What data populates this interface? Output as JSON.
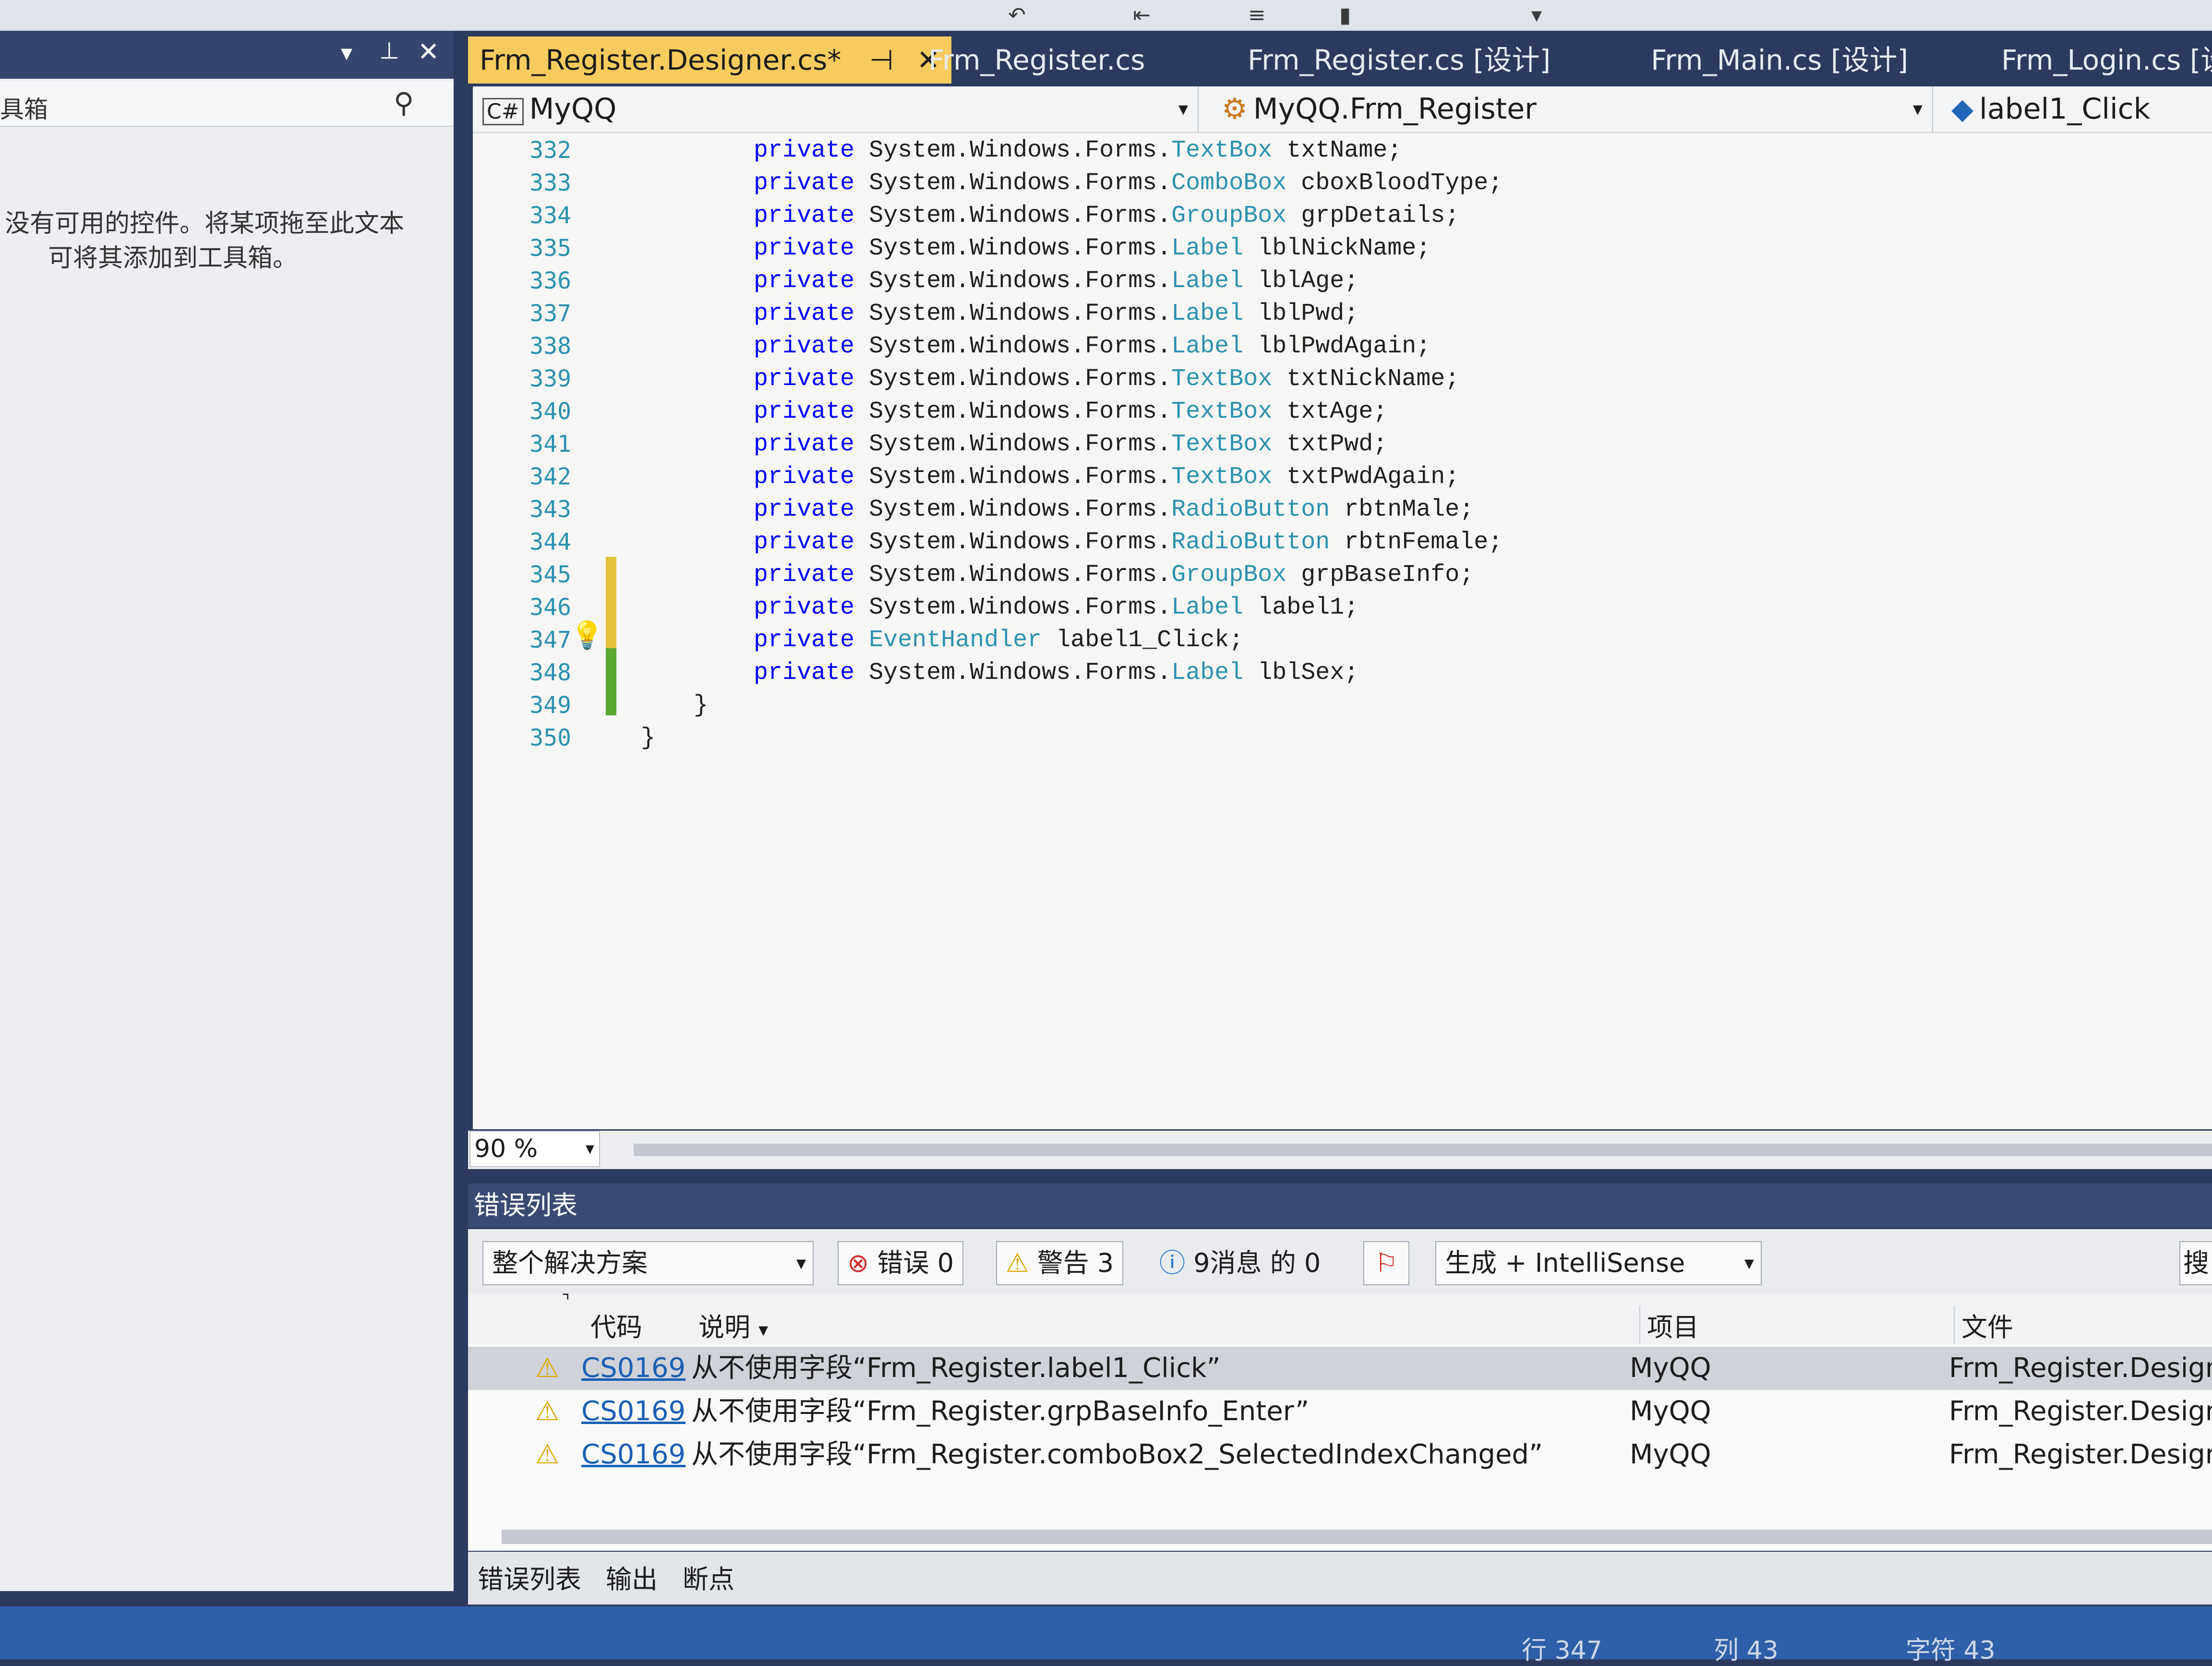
{
  "toolbox": {
    "title": "具箱",
    "empty_message_line1": "没有可用的控件。将某项拖至此文本",
    "empty_message_line2": "可将其添加到工具箱。"
  },
  "tabs": [
    {
      "label": "Frm_Register.Designer.cs*",
      "active": true
    },
    {
      "label": "Frm_Register.cs"
    },
    {
      "label": "Frm_Register.cs [设计]"
    },
    {
      "label": "Frm_Main.cs [设计]"
    },
    {
      "label": "Frm_Login.cs [设计"
    }
  ],
  "navbar": {
    "project": "MyQQ",
    "class": "MyQQ.Frm_Register",
    "member": "label1_Click"
  },
  "code_lines": [
    {
      "n": "332",
      "type": "TextBox",
      "name": "txtName;",
      "prefix": "System.Windows.Forms."
    },
    {
      "n": "333",
      "type": "ComboBox",
      "name": "cboxBloodType;",
      "prefix": "System.Windows.Forms."
    },
    {
      "n": "334",
      "type": "GroupBox",
      "name": "grpDetails;",
      "prefix": "System.Windows.Forms."
    },
    {
      "n": "335",
      "type": "Label",
      "name": "lblNickName;",
      "prefix": "System.Windows.Forms."
    },
    {
      "n": "336",
      "type": "Label",
      "name": "lblAge;",
      "prefix": "System.Windows.Forms."
    },
    {
      "n": "337",
      "type": "Label",
      "name": "lblPwd;",
      "prefix": "System.Windows.Forms."
    },
    {
      "n": "338",
      "type": "Label",
      "name": "lblPwdAgain;",
      "prefix": "System.Windows.Forms."
    },
    {
      "n": "339",
      "type": "TextBox",
      "name": "txtNickName;",
      "prefix": "System.Windows.Forms."
    },
    {
      "n": "340",
      "type": "TextBox",
      "name": "txtAge;",
      "prefix": "System.Windows.Forms."
    },
    {
      "n": "341",
      "type": "TextBox",
      "name": "txtPwd;",
      "prefix": "System.Windows.Forms."
    },
    {
      "n": "342",
      "type": "TextBox",
      "name": "txtPwdAgain;",
      "prefix": "System.Windows.Forms."
    },
    {
      "n": "343",
      "type": "RadioButton",
      "name": "rbtnMale;",
      "prefix": "System.Windows.Forms."
    },
    {
      "n": "344",
      "type": "RadioButton",
      "name": "rbtnFemale;",
      "prefix": "System.Windows.Forms."
    },
    {
      "n": "345",
      "type": "GroupBox",
      "name": "grpBaseInfo;",
      "prefix": "System.Windows.Forms."
    },
    {
      "n": "346",
      "type": "Label",
      "name": "label1;",
      "prefix": "System.Windows.Forms."
    },
    {
      "n": "347",
      "type": "EventHandler",
      "name": "label1_Click;",
      "prefix": ""
    },
    {
      "n": "348",
      "type": "Label",
      "name": "lblSex;",
      "prefix": "System.Windows.Forms."
    },
    {
      "n": "349",
      "brace": "}"
    },
    {
      "n": "350",
      "brace": "}"
    }
  ],
  "keyword": "private",
  "zoom": "90 %",
  "error_list": {
    "title": "错误列表",
    "scope": "整个解决方案",
    "errors_label": "错误 0",
    "warnings_label": "警告 3",
    "messages_label": "9消息 的 0",
    "build_filter": "生成 + IntelliSense",
    "search_label": "搜",
    "columns": {
      "code": "代码",
      "desc": "说明",
      "project": "项目",
      "file": "文件"
    },
    "rows": [
      {
        "code": "CS0169",
        "desc": "从不使用字段“Frm_Register.label1_Click”",
        "project": "MyQQ",
        "file": "Frm_Register.Designe",
        "selected": true
      },
      {
        "code": "CS0169",
        "desc": "从不使用字段“Frm_Register.grpBaseInfo_Enter”",
        "project": "MyQQ",
        "file": "Frm_Register.Designe"
      },
      {
        "code": "CS0169",
        "desc": "从不使用字段“Frm_Register.comboBox2_SelectedIndexChanged”",
        "project": "MyQQ",
        "file": "Frm_Register.Designe"
      }
    ]
  },
  "bottom_tabs": [
    "错误列表",
    "输出",
    "断点"
  ],
  "status": {
    "line": "行 347",
    "col": "列 43",
    "char": "字符 43"
  }
}
